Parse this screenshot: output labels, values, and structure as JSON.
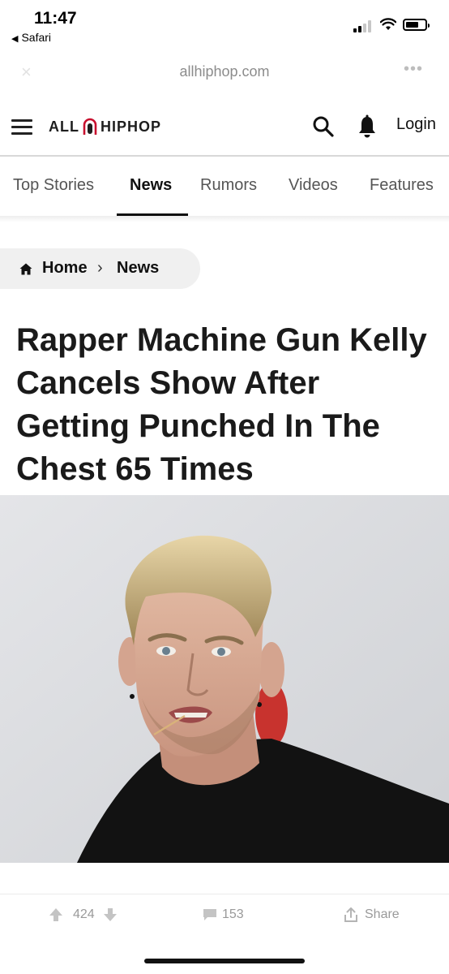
{
  "status_bar": {
    "time": "11:47",
    "back_app": "Safari",
    "signal_bars": 4,
    "signal_active": 2
  },
  "browser": {
    "url": "allhiphop.com",
    "close_icon": "×",
    "more_icon": "•••"
  },
  "site": {
    "logo_left": "ALL",
    "logo_right": "HIPHOP",
    "login_label": "Login"
  },
  "nav": {
    "tabs": [
      {
        "label": "Top Stories",
        "active": false
      },
      {
        "label": "News",
        "active": true
      },
      {
        "label": "Rumors",
        "active": false
      },
      {
        "label": "Videos",
        "active": false
      },
      {
        "label": "Features",
        "active": false
      }
    ]
  },
  "breadcrumb": {
    "home": "Home",
    "separator": "›",
    "current": "News"
  },
  "article": {
    "headline": "Rapper Machine Gun Kelly Cancels Show After Getting Punched In The Chest 65 Times"
  },
  "actions": {
    "votes": "424",
    "comments": "153",
    "share": "Share"
  },
  "colors": {
    "accent": "#111111",
    "muted": "#9a9a9a",
    "breadcrumb_bg": "#f0f0f0"
  }
}
